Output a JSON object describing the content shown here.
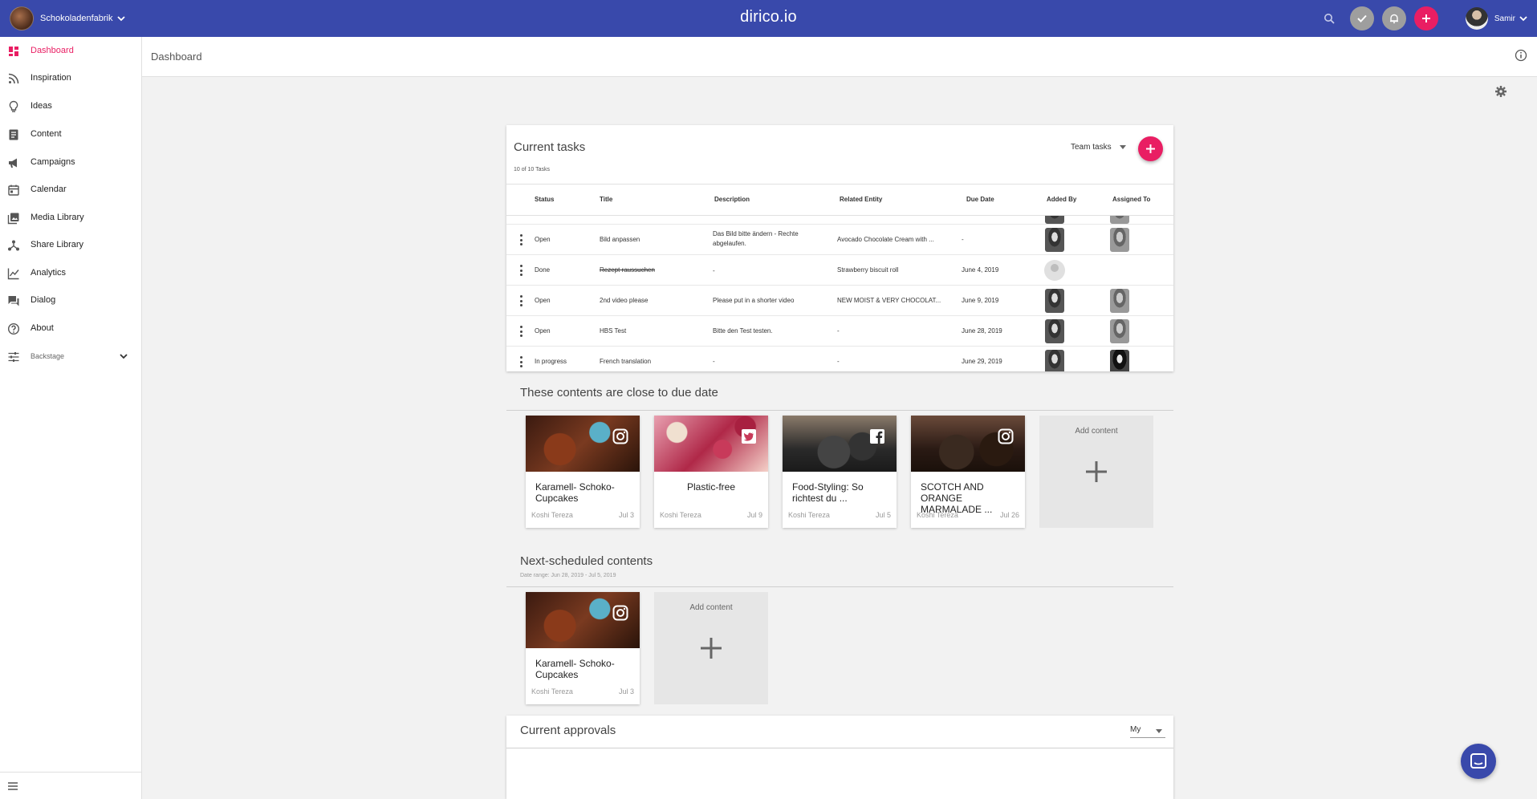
{
  "topbar": {
    "org_name": "Schokoladenfabrik",
    "brand": "dirico.io",
    "user_name": "Samir"
  },
  "sidebar": {
    "items": [
      {
        "label": "Dashboard",
        "icon": "dashboard-icon"
      },
      {
        "label": "Inspiration",
        "icon": "rss-icon"
      },
      {
        "label": "Ideas",
        "icon": "lightbulb-icon"
      },
      {
        "label": "Content",
        "icon": "document-icon"
      },
      {
        "label": "Campaigns",
        "icon": "megaphone-icon"
      },
      {
        "label": "Calendar",
        "icon": "calendar-icon"
      },
      {
        "label": "Media Library",
        "icon": "photo-library-icon"
      },
      {
        "label": "Share Library",
        "icon": "share-icon"
      },
      {
        "label": "Analytics",
        "icon": "chart-icon"
      },
      {
        "label": "Dialog",
        "icon": "chat-icon"
      },
      {
        "label": "About",
        "icon": "help-icon"
      }
    ],
    "backstage_label": "Backstage"
  },
  "header": {
    "title": "Dashboard"
  },
  "tasks": {
    "title": "Current tasks",
    "count": "10 of 10 Tasks",
    "filter": "Team tasks",
    "columns": [
      "Status",
      "Title",
      "Description",
      "Related Entity",
      "Due Date",
      "Added By",
      "Assigned To"
    ],
    "rows": [
      {
        "status": "Open",
        "title": "Bild anpassen",
        "description": "Das Bild bitte ändern - Rechte abgelaufen.",
        "entity": "Avocado Chocolate Cream with ...",
        "due": "-"
      },
      {
        "status": "Done",
        "title": "Rezept raussuchen",
        "description": "-",
        "entity": "Strawberry biscuit roll",
        "due": "June 4, 2019"
      },
      {
        "status": "Open",
        "title": "2nd video please",
        "description": "Please put in a shorter video",
        "entity": "NEW MOIST & VERY CHOCOLAT...",
        "due": "June 9, 2019"
      },
      {
        "status": "Open",
        "title": "HBS Test",
        "description": "Bitte den Test testen.",
        "entity": "-",
        "due": "June 28, 2019"
      },
      {
        "status": "In progress",
        "title": "French translation",
        "description": "-",
        "entity": "-",
        "due": "June 29, 2019"
      }
    ]
  },
  "due_section": {
    "title": "These contents are close to due date",
    "cards": [
      {
        "title": "Karamell- Schoko-Cupcakes",
        "author": "Koshi Tereza",
        "date": "Jul 3",
        "network": "instagram-icon"
      },
      {
        "title": "Plastic-free",
        "author": "Koshi Tereza",
        "date": "Jul 9",
        "network": "twitter-icon"
      },
      {
        "title": "Food-Styling: So richtest du ...",
        "author": "Koshi Tereza",
        "date": "Jul 5",
        "network": "facebook-icon"
      },
      {
        "title": "SCOTCH AND ORANGE MARMALADE ...",
        "author": "Koshi Tereza",
        "date": "Jul 26",
        "network": "instagram-icon"
      }
    ],
    "add_label": "Add content"
  },
  "next_section": {
    "title": "Next-scheduled contents",
    "subtitle": "Date range: Jun 28, 2019 - Jul 5, 2019",
    "cards": [
      {
        "title": "Karamell- Schoko-Cupcakes",
        "author": "Koshi Tereza",
        "date": "Jul 3",
        "network": "instagram-icon"
      }
    ],
    "add_label": "Add content"
  },
  "approvals": {
    "title": "Current approvals",
    "filter": "My"
  },
  "colors": {
    "primary": "#3949ab",
    "accent": "#e91e63"
  }
}
